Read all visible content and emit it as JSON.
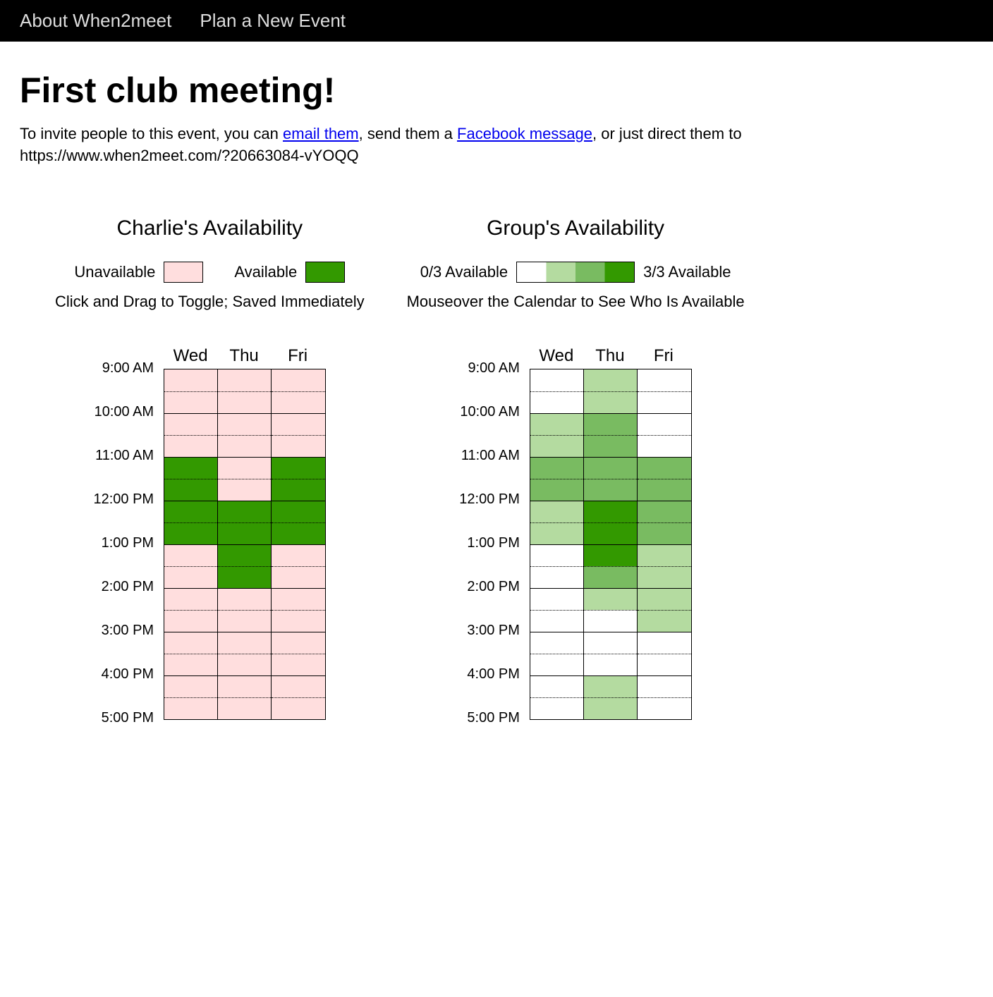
{
  "nav": {
    "about": "About When2meet",
    "new_event": "Plan a New Event"
  },
  "event": {
    "title": "First club meeting!",
    "invite_prefix": "To invite people to this event, you can ",
    "email_link": "email them",
    "invite_mid1": ", send them a ",
    "fb_link": "Facebook message",
    "invite_mid2": ", or just direct them to ",
    "url": "https://www.when2meet.com/?20663084-vYOQQ"
  },
  "left": {
    "title": "Charlie's Availability",
    "legend_unavail": "Unavailable",
    "legend_avail": "Available",
    "hint": "Click and Drag to Toggle; Saved Immediately"
  },
  "right": {
    "title": "Group's Availability",
    "legend_min": "0/3 Available",
    "legend_max": "3/3 Available",
    "hint": "Mouseover the Calendar to See Who Is Available"
  },
  "days": [
    "Wed",
    "Thu",
    "Fri"
  ],
  "times": [
    "9:00 AM",
    "10:00 AM",
    "11:00 AM",
    "12:00 PM",
    "1:00 PM",
    "2:00 PM",
    "3:00 PM",
    "4:00 PM",
    "5:00 PM"
  ],
  "my_avail": [
    [
      0,
      0,
      0
    ],
    [
      0,
      0,
      0
    ],
    [
      0,
      0,
      0
    ],
    [
      0,
      0,
      0
    ],
    [
      1,
      0,
      1
    ],
    [
      1,
      0,
      1
    ],
    [
      1,
      1,
      1
    ],
    [
      1,
      1,
      1
    ],
    [
      0,
      1,
      0
    ],
    [
      0,
      1,
      0
    ],
    [
      0,
      0,
      0
    ],
    [
      0,
      0,
      0
    ],
    [
      0,
      0,
      0
    ],
    [
      0,
      0,
      0
    ],
    [
      0,
      0,
      0
    ],
    [
      0,
      0,
      0
    ]
  ],
  "group_avail": [
    [
      0,
      1,
      0
    ],
    [
      0,
      1,
      0
    ],
    [
      1,
      2,
      0
    ],
    [
      1,
      2,
      0
    ],
    [
      2,
      2,
      2
    ],
    [
      2,
      2,
      2
    ],
    [
      1,
      3,
      2
    ],
    [
      1,
      3,
      2
    ],
    [
      0,
      3,
      1
    ],
    [
      0,
      2,
      1
    ],
    [
      0,
      1,
      1
    ],
    [
      0,
      0,
      1
    ],
    [
      0,
      0,
      0
    ],
    [
      0,
      0,
      0
    ],
    [
      0,
      1,
      0
    ],
    [
      0,
      1,
      0
    ]
  ]
}
